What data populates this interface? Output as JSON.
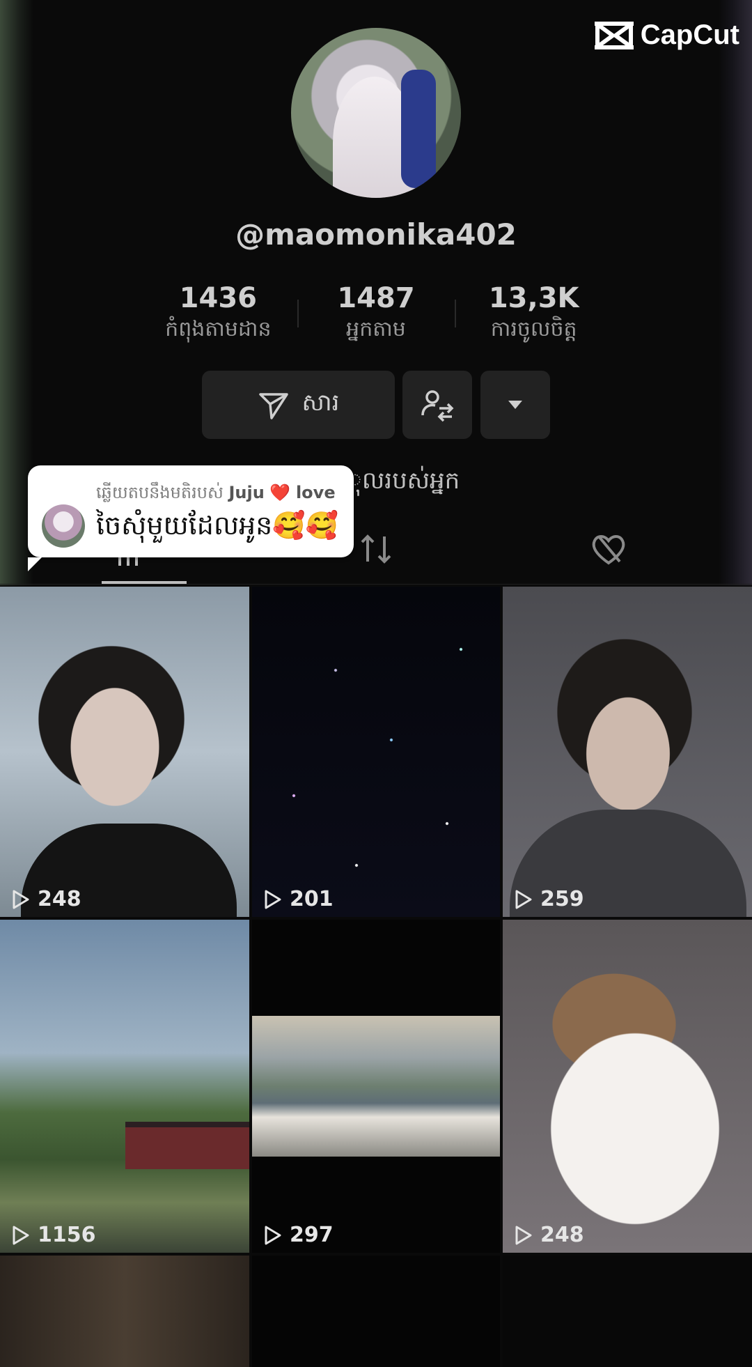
{
  "watermark": {
    "brand": "CapCut"
  },
  "profile": {
    "username": "@maomonika402",
    "stats": [
      {
        "value": "1436",
        "label": "កំពុងតាមដាន"
      },
      {
        "value": "1487",
        "label": "អ្នកតាម"
      },
      {
        "value": "13,3K",
        "label": "ការចូលចិត្ត"
      }
    ],
    "message_button": "សារ",
    "bio_fragment": "ុលរបស់អ្នក"
  },
  "reply_bubble": {
    "reply_prefix": "ឆ្លើយតបនឹងមតិរបស់",
    "reply_user": "Juju",
    "reply_heart": "❤️",
    "reply_suffix": "love",
    "message": "ចៃសុំមួយដែលអូន🥰🥰"
  },
  "videos": [
    {
      "views": "248"
    },
    {
      "views": "201"
    },
    {
      "views": "259"
    },
    {
      "views": "1156"
    },
    {
      "views": "297"
    },
    {
      "views": "248"
    }
  ],
  "colors": {
    "background": "#0a0a0a",
    "button": "#222222",
    "heart": "#e3202a"
  }
}
